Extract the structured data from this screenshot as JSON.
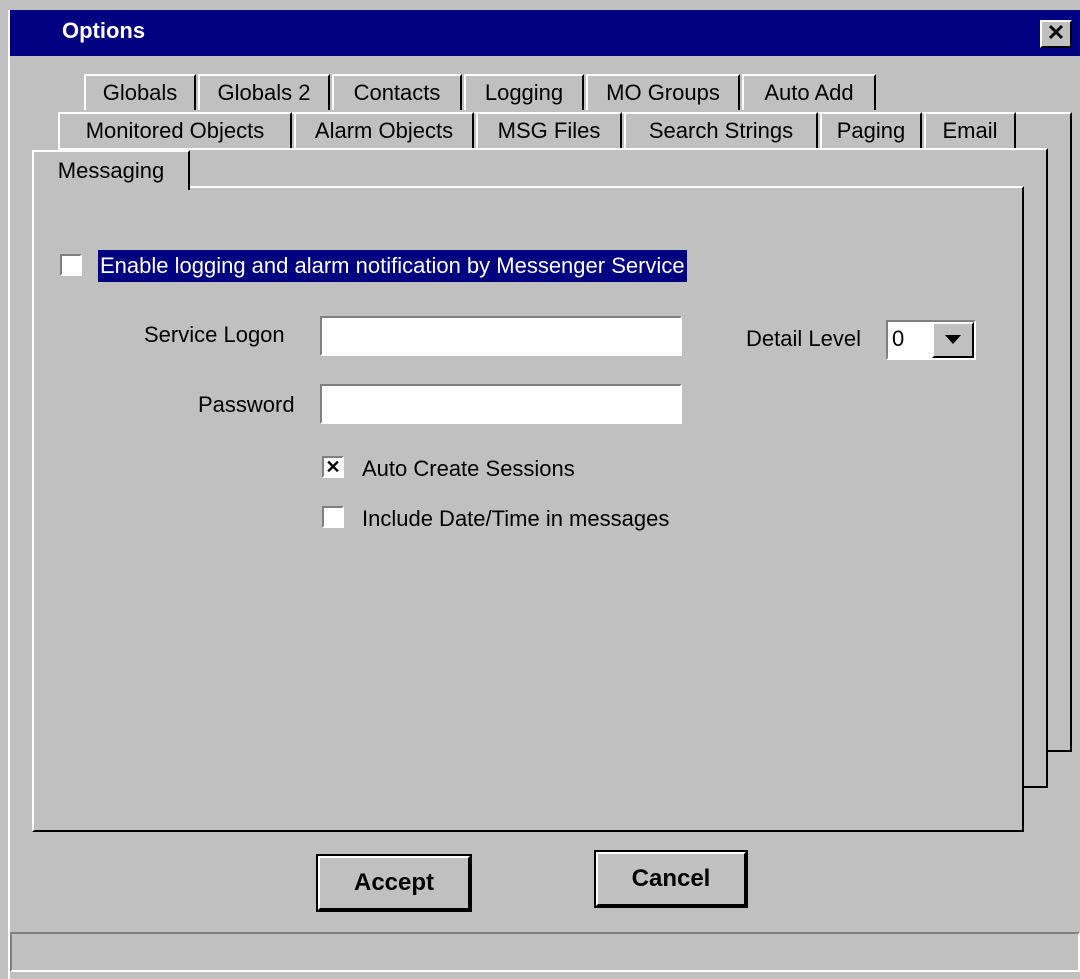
{
  "window": {
    "title": "Options",
    "close_label": "✕"
  },
  "tabs": {
    "row1": [
      "Globals",
      "Globals 2",
      "Contacts",
      "Logging",
      "MO Groups",
      "Auto Add"
    ],
    "row2": [
      "Monitored Objects",
      "Alarm Objects",
      "MSG Files",
      "Search Strings",
      "Paging",
      "Email"
    ],
    "active": "Messaging"
  },
  "form": {
    "enable_label": "Enable logging and alarm notification by Messenger Service",
    "enable_checked": false,
    "service_logon_label": "Service Logon",
    "service_logon_value": "",
    "password_label": "Password",
    "password_value": "",
    "detail_level_label": "Detail Level",
    "detail_level_value": "0",
    "auto_create_label": "Auto Create Sessions",
    "auto_create_mark": "✕",
    "include_datetime_label": "Include Date/Time in messages"
  },
  "buttons": {
    "accept": "Accept",
    "cancel": "Cancel"
  },
  "colors": {
    "face": "#c0c0c0",
    "titlebar": "#000080",
    "highlight": "#000080"
  }
}
